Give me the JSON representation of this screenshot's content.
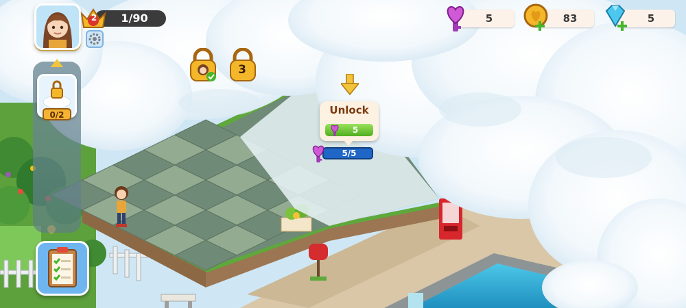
{
  "player": {
    "level": "2",
    "xp_text": "1/90"
  },
  "resources": {
    "hearts": "5",
    "coins": "83",
    "gems": "5"
  },
  "side_panel": {
    "expansion_count": "0/2"
  },
  "locks": {
    "next_lock_number": "3"
  },
  "unlock_popup": {
    "title": "Unlock",
    "cost": "5",
    "progress_text": "5/5",
    "progress_fraction": 1.0
  },
  "colors": {
    "grass": "#6ab04c",
    "tile_dark": "#6f8a76",
    "tile_light": "#93ab91",
    "water": "#38b6d8",
    "cloud": "#ffffff",
    "heart_pink": "#d05ad6",
    "coin_gold": "#f4b72a",
    "gem_blue": "#4ec7ee",
    "plus_green": "#46b62a"
  },
  "icons": [
    "avatar-girl",
    "crown-icon",
    "gear-icon",
    "heart-key-icon",
    "coin-icon",
    "gem-icon",
    "plus-icon",
    "lock-icon",
    "checkmark-icon",
    "arrow-down-icon",
    "clipboard-icon",
    "cloud-lock-icon"
  ]
}
